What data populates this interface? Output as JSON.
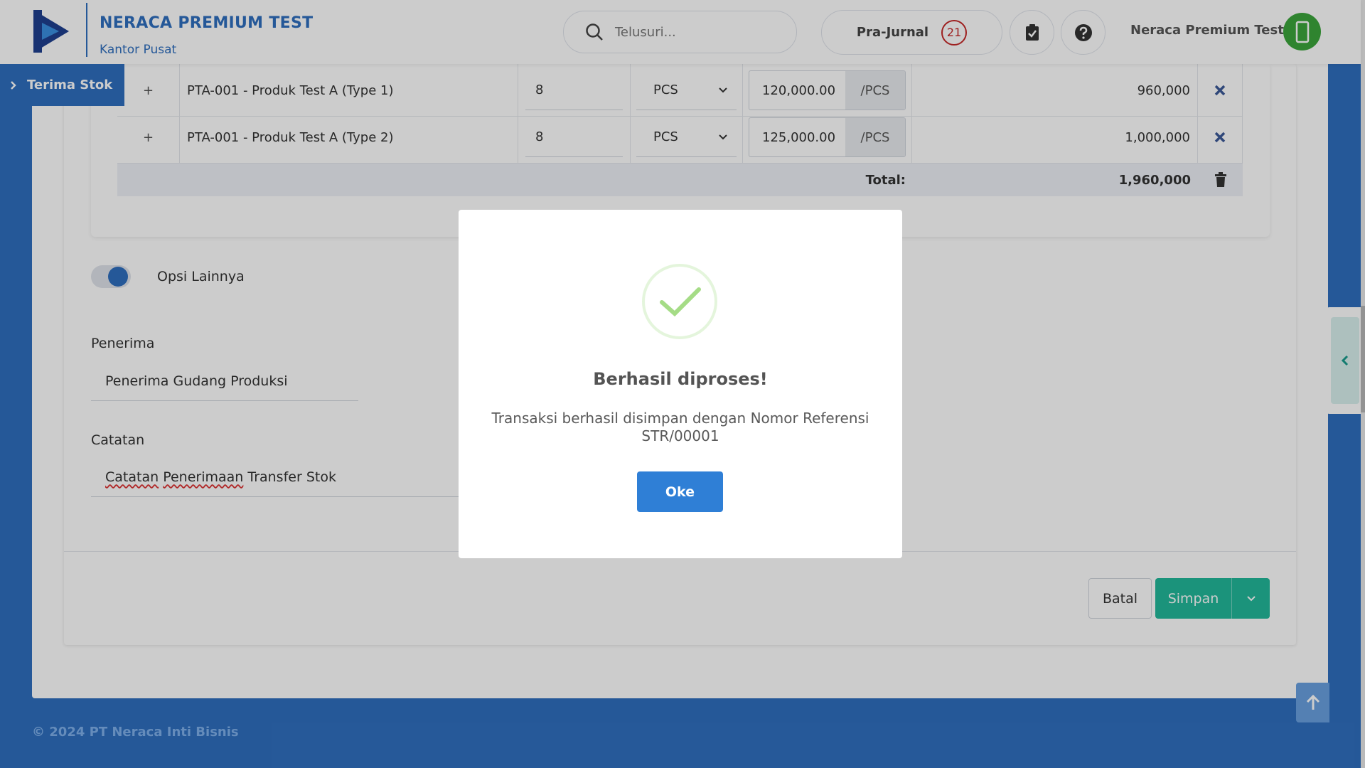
{
  "header": {
    "company": "NERACA PREMIUM TEST",
    "branch": "Kantor Pusat",
    "search_placeholder": "Telusuri...",
    "pre_journal_label": "Pra-Jurnal",
    "pre_journal_count": "21",
    "user_name": "Neraca Premium Test"
  },
  "page_tab": {
    "chevron": ">",
    "label": "Terima Stok"
  },
  "table": {
    "rows": [
      {
        "expand": "+",
        "product": "PTA-001 - Produk Test A (Type 1)",
        "qty": "8",
        "unit": "PCS",
        "price": "120,000.00",
        "price_unit": "/PCS",
        "amount": "960,000"
      },
      {
        "expand": "+",
        "product": "PTA-001 - Produk Test A (Type 2)",
        "qty": "8",
        "unit": "PCS",
        "price": "125,000.00",
        "price_unit": "/PCS",
        "amount": "1,000,000"
      }
    ],
    "total_label": "Total:",
    "total_value": "1,960,000"
  },
  "options": {
    "toggle_label": "Opsi Lainnya",
    "toggle_on": true,
    "recipient_label": "Penerima",
    "recipient_value": "Penerima Gudang Produksi",
    "note_label": "Catatan",
    "note_word1": "Catatan",
    "note_word2": "Penerimaan",
    "note_rest": "Transfer Stok"
  },
  "actions": {
    "cancel": "Batal",
    "save": "Simpan"
  },
  "footer": {
    "copyright": "© 2024 PT Neraca Inti Bisnis"
  },
  "modal": {
    "title": "Berhasil diproses!",
    "message": "Transaksi berhasil disimpan dengan Nomor Referensi STR/00001",
    "ok_button": "Oke"
  },
  "colors": {
    "brand_blue": "#2f6fbf",
    "success_green": "#22b89a",
    "badge_red": "#c62828",
    "check_green": "#a5dc86"
  },
  "icons": [
    "logo-icon",
    "search-icon",
    "clipboard-check-icon",
    "help-icon",
    "phone-icon",
    "chevron-right-icon",
    "chevron-down-icon",
    "close-icon",
    "trash-icon",
    "chevron-left-icon",
    "arrow-up-icon",
    "success-check-icon"
  ]
}
